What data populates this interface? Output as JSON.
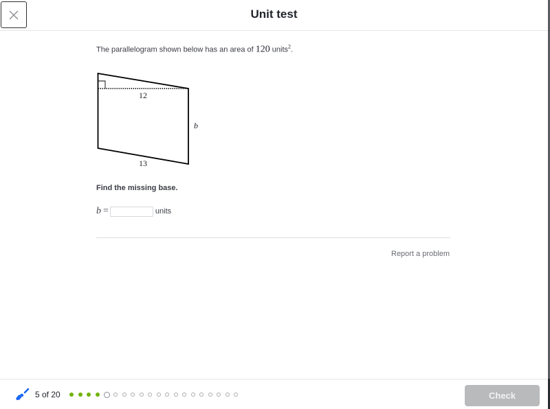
{
  "header": {
    "title": "Unit test",
    "close_icon": "close-icon"
  },
  "question": {
    "prompt_prefix": "The parallelogram shown below has an area of ",
    "area_value": "120",
    "area_unit": " units",
    "area_exponent": "2",
    "prompt_suffix": ".",
    "figure": {
      "height_label": "12",
      "base_label": "13",
      "side_label": "b",
      "right_angle_marker": true
    },
    "instruction": "Find the missing base.",
    "answer": {
      "variable": "b",
      "equals": "=",
      "value": "",
      "placeholder": "",
      "unit": "units"
    },
    "report_link": "Report a problem"
  },
  "footer": {
    "skill_icon": "skill-squiggle-icon",
    "progress_text": "5 of 20",
    "progress": {
      "current": 5,
      "total": 20,
      "completed": 4
    },
    "check_label": "Check",
    "colors": {
      "completed_dot": "#71b307",
      "check_disabled": "#b9babc"
    }
  }
}
